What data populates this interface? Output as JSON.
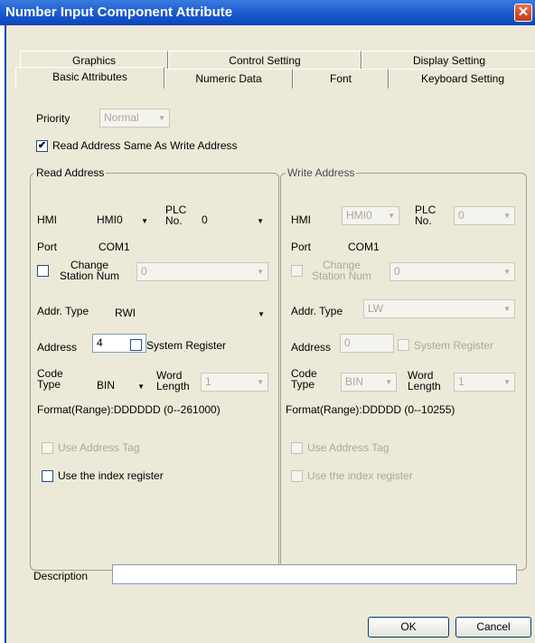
{
  "window": {
    "title": "Number Input Component Attribute",
    "close_glyph": "✕"
  },
  "tabs_row1": [
    "Graphics",
    "Control Setting",
    "Display Setting"
  ],
  "tabs_row2": [
    "Basic Attributes",
    "Numeric Data",
    "Font",
    "Keyboard Setting"
  ],
  "priority": {
    "label": "Priority",
    "value": "Normal"
  },
  "read_same_write": {
    "label": "Read Address Same As Write Address",
    "checked": true,
    "mark": "✔"
  },
  "read": {
    "title": "Read Address",
    "hmi_label": "HMI",
    "hmi_value": "HMI0",
    "plc_label": "PLC No.",
    "plc_value": "0",
    "port_label": "Port",
    "port_value": "COM1",
    "change_station_label": "Change Station Num",
    "change_station_value": "0",
    "addr_type_label": "Addr. Type",
    "addr_type_value": "RWI",
    "address_label": "Address",
    "address_value": "4",
    "system_register_label": "System Register",
    "code_type_label": "Code Type",
    "code_type_value": "BIN",
    "word_length_label": "Word Length",
    "word_length_value": "1",
    "format": "Format(Range):DDDDDD (0--261000)",
    "use_address_tag": "Use Address Tag",
    "use_index_register": "Use the index register"
  },
  "write": {
    "title": "Write Address",
    "hmi_label": "HMI",
    "hmi_value": "HMI0",
    "plc_label": "PLC No.",
    "plc_value": "0",
    "port_label": "Port",
    "port_value": "COM1",
    "change_station_label": "Change Station Num",
    "change_station_value": "0",
    "addr_type_label": "Addr. Type",
    "addr_type_value": "LW",
    "address_label": "Address",
    "address_value": "0",
    "system_register_label": "System Register",
    "code_type_label": "Code Type",
    "code_type_value": "BIN",
    "word_length_label": "Word Length",
    "word_length_value": "1",
    "format": "Format(Range):DDDDD (0--10255)",
    "use_address_tag": "Use Address Tag",
    "use_index_register": "Use the index register"
  },
  "description": {
    "label": "Description",
    "value": ""
  },
  "buttons": {
    "ok": "OK",
    "cancel": "Cancel"
  },
  "icons": {
    "dropdown_arrow": "▼"
  }
}
